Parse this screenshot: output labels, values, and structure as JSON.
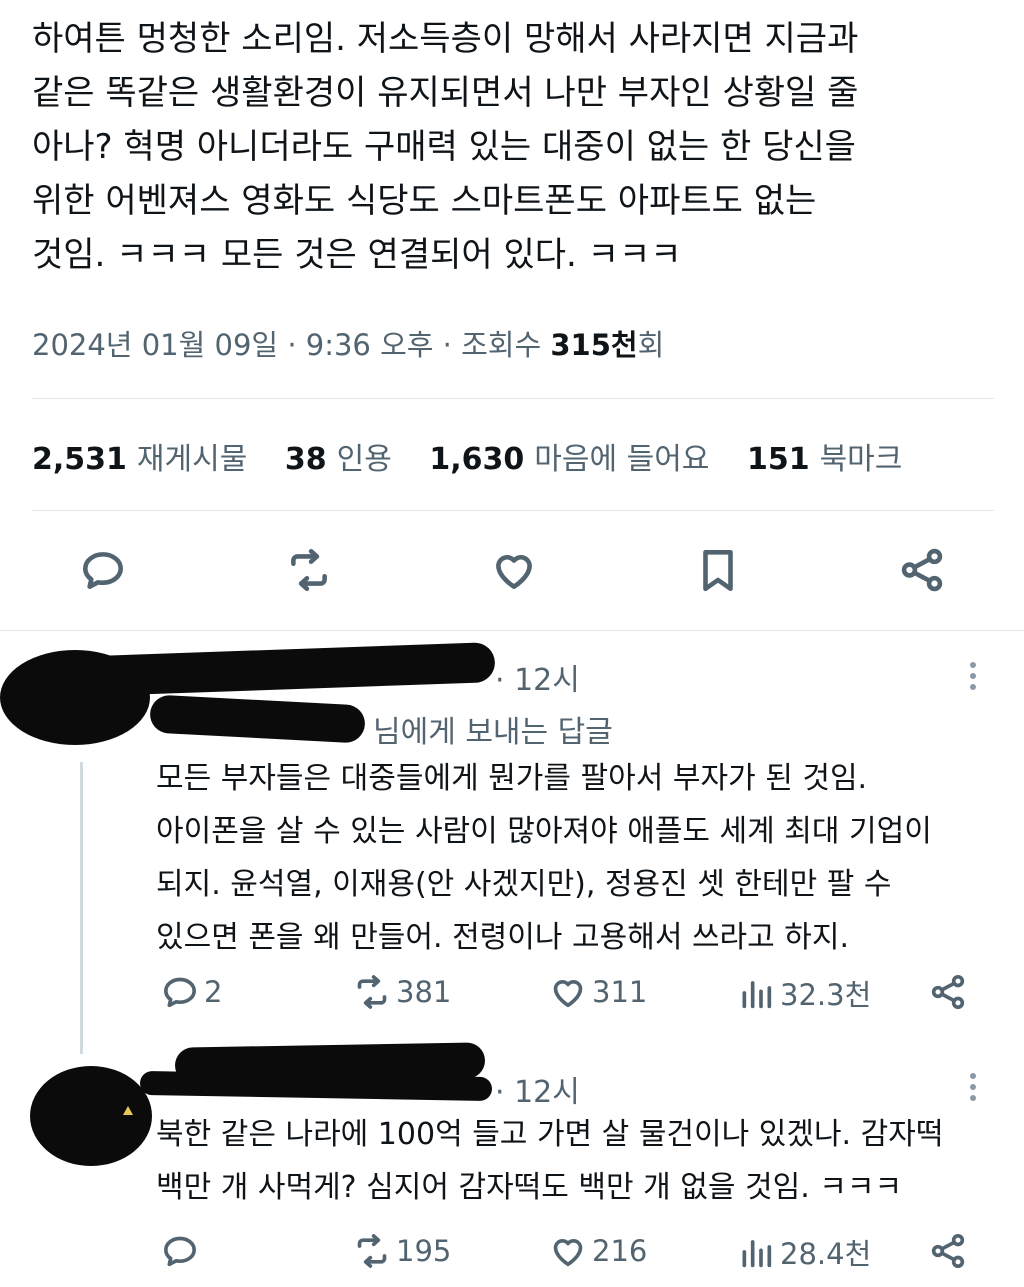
{
  "tweet": {
    "lines": [
      "하여튼 멍청한 소리임. 저소득층이 망해서 사라지면 지금과",
      "같은 똑같은 생활환경이 유지되면서 나만 부자인 상황일 줄",
      "아나? 혁명 아니더라도 구매력 있는 대중이 없는 한 당신을",
      "위한 어벤져스 영화도 식당도 스마트폰도 아파트도 없는",
      "것임. ㅋㅋㅋ 모든 것은 연결되어 있다. ㅋㅋㅋ"
    ],
    "date": "2024년 01월 09일",
    "time": "9:36 오후",
    "views_label": "조회수",
    "views_value": "315천",
    "views_suffix": "회",
    "sep": "·"
  },
  "stats": [
    {
      "value": "2,531",
      "label": "재게시물"
    },
    {
      "value": "38",
      "label": "인용"
    },
    {
      "value": "1,630",
      "label": "마음에 들어요"
    },
    {
      "value": "151",
      "label": "북마크"
    }
  ],
  "actions": [
    "reply-icon",
    "repost-icon",
    "heart-icon",
    "bookmark-icon",
    "share-icon"
  ],
  "replies": [
    {
      "time": "· 12시",
      "replying_to": "님에게 보내는 답글",
      "lines": [
        "모든 부자들은 대중들에게 뭔가를  팔아서 부자가 된 것임.",
        "아이폰을 살 수 있는 사람이 많아져야 애플도 세계 최대 기업이",
        "되지. 윤석열, 이재용(안 사겠지만), 정용진 셋 한테만 팔 수",
        "있으면 폰을 왜 만들어. 전령이나 고용해서 쓰라고 하지."
      ],
      "reply_count": "2",
      "repost_count": "381",
      "like_count": "311",
      "view_count": "32.3천"
    },
    {
      "time": "· 12시",
      "lines": [
        "북한 같은 나라에 100억 들고 가면 살 물건이나 있겠나. 감자떡",
        "백만 개 사먹게? 심지어 감자떡도 백만 개 없을 것임. ㅋㅋㅋ"
      ],
      "reply_count": "",
      "repost_count": "195",
      "like_count": "216",
      "view_count": "28.4천"
    }
  ],
  "colors": {
    "text": "#0f1419",
    "secondary": "#536471",
    "divider": "#e3e7ea",
    "redaction": "#0b0b0b"
  }
}
